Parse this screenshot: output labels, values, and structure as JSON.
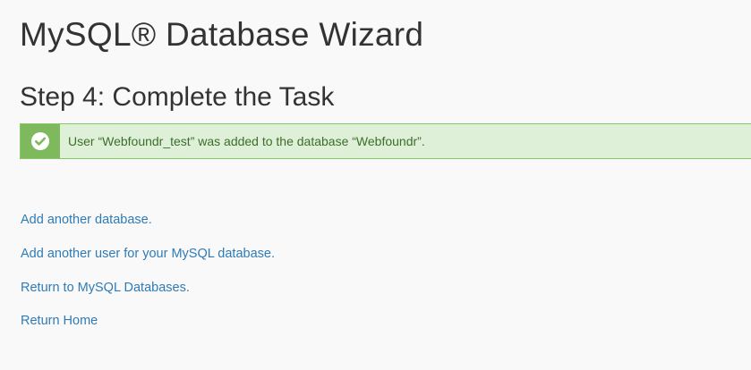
{
  "page": {
    "title": "MySQL® Database Wizard",
    "step_title": "Step 4: Complete the Task"
  },
  "alert": {
    "status": "success",
    "icon": "check-circle-icon",
    "message": "User “Webfoundr_test” was added to the database “Webfoundr”.",
    "colors": {
      "background": "#dff0d8",
      "border": "#8ac46b",
      "icon_box": "#7fb95d",
      "text": "#3c6e2b"
    }
  },
  "links": [
    {
      "label": "Add another database."
    },
    {
      "label": "Add another user for your MySQL database."
    },
    {
      "label": "Return to MySQL Databases."
    },
    {
      "label": "Return Home"
    }
  ],
  "colors": {
    "link": "#2f7bb5",
    "heading": "#333333",
    "background": "#f9f9f9"
  }
}
